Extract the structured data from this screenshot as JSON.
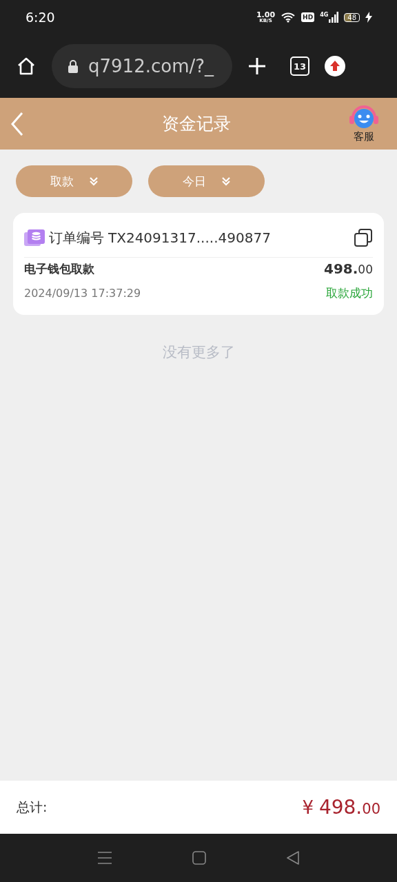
{
  "status_bar": {
    "time": "6:20",
    "speed": "1.00",
    "speed_unit": "KB/S",
    "hd": "HD",
    "network": "4G",
    "battery": "48",
    "charging": true
  },
  "browser": {
    "url": "q7912.com/?_",
    "tab_count": "13"
  },
  "header": {
    "title": "资金记录",
    "service_label": "客服"
  },
  "filters": [
    {
      "label": "取款"
    },
    {
      "label": "今日"
    }
  ],
  "records": [
    {
      "order_label": "订单编号",
      "order_no": "TX24091317.....490877",
      "type": "电子钱包取款",
      "amount_int": "498.",
      "amount_dec": "00",
      "time": "2024/09/13 17:37:29",
      "status": "取款成功",
      "success": true
    }
  ],
  "end_note": "没有更多了",
  "footer": {
    "label": "总计:",
    "currency": "¥",
    "amount_int": "498.",
    "amount_dec": "00"
  }
}
